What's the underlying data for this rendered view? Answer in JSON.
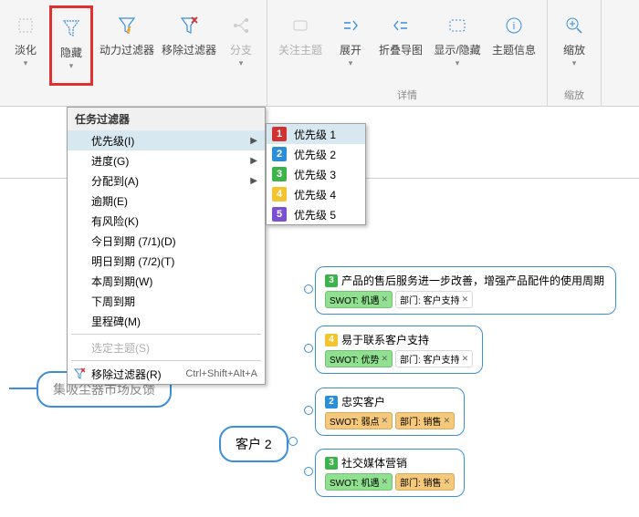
{
  "ribbon": {
    "group1": {
      "btn_fade": "淡化",
      "btn_hide": "隐藏",
      "btn_power_filter": "动力过滤器",
      "btn_remove_filter": "移除过滤器",
      "btn_branch": "分支"
    },
    "group2": {
      "btn_focus_topic": "关注主题",
      "btn_expand": "展开",
      "btn_collapse_nav": "折叠导图",
      "btn_show_hide": "显示/隐藏",
      "btn_topic_info": "主题信息",
      "label": "详情"
    },
    "group3": {
      "btn_zoom": "缩放",
      "label": "缩放"
    }
  },
  "menu": {
    "title": "任务过滤器",
    "items": {
      "priority": "优先级(I)",
      "progress": "进度(G)",
      "assigned": "分配到(A)",
      "overdue": "逾期(E)",
      "risk": "有风险(K)",
      "due_today": "今日到期 (7/1)(D)",
      "due_tomorrow": "明日到期 (7/2)(T)",
      "due_week": "本周到期(W)",
      "due_next_week": "下周到期",
      "milestone": "里程碑(M)",
      "selected_topic": "选定主题(S)",
      "remove_filter": "移除过滤器(R)",
      "remove_filter_accel": "Ctrl+Shift+Alt+A"
    }
  },
  "submenu": {
    "p1": "优先级 1",
    "p2": "优先级 2",
    "p3": "优先级 3",
    "p4": "优先级 4",
    "p5": "优先级 5"
  },
  "colors": {
    "p1": "#d23131",
    "p2": "#2a8fd8",
    "p3": "#3cb44b",
    "p4": "#f4c430",
    "p5": "#7a4fd0",
    "tag_green": "#8fe08f",
    "tag_orange": "#f5c87a",
    "tag_blue_border": "#3a8fd8"
  },
  "mindmap": {
    "root": "集吸尘器市场反馈",
    "customer2": "客户 2",
    "nodes": {
      "n1": {
        "num": "3",
        "title": "产品的售后服务进一步改善，增强产品配件的使用周期",
        "tags": [
          {
            "t": "SWOT: 机遇",
            "c": "#8fe08f"
          },
          {
            "t": "部门: 客户支持",
            "c": "#ffffff"
          }
        ]
      },
      "n2": {
        "num": "4",
        "title": "易于联系客户支持",
        "tags": [
          {
            "t": "SWOT: 优势",
            "c": "#8fe08f"
          },
          {
            "t": "部门: 客户支持",
            "c": "#ffffff"
          }
        ]
      },
      "n3": {
        "num": "2",
        "title": "忠实客户",
        "tags": [
          {
            "t": "SWOT: 弱点",
            "c": "#f5c87a"
          },
          {
            "t": "部门: 销售",
            "c": "#f5c87a"
          }
        ]
      },
      "n4": {
        "num": "3",
        "title": "社交媒体营销",
        "tags": [
          {
            "t": "SWOT: 机遇",
            "c": "#8fe08f"
          },
          {
            "t": "部门: 销售",
            "c": "#f5c87a"
          }
        ]
      }
    }
  }
}
